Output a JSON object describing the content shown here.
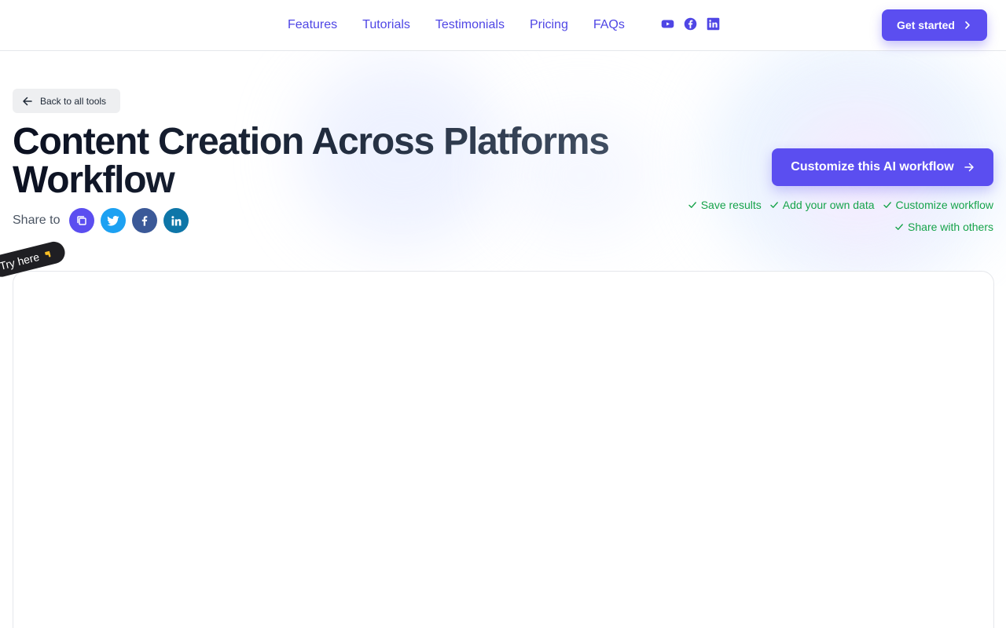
{
  "nav": {
    "items": [
      {
        "label": "Features"
      },
      {
        "label": "Tutorials"
      },
      {
        "label": "Testimonials"
      },
      {
        "label": "Pricing"
      },
      {
        "label": "FAQs"
      }
    ],
    "socials": [
      "youtube-icon",
      "facebook-icon",
      "linkedin-icon"
    ],
    "cta_label": "Get started"
  },
  "back_label": "Back to all tools",
  "title": "Content Creation Across Platforms Workflow",
  "share": {
    "label": "Share to",
    "buttons": [
      "copy-link-icon",
      "twitter-icon",
      "facebook-icon",
      "linkedin-icon"
    ]
  },
  "customize_label": "Customize this AI workflow",
  "features": [
    "Save results",
    "Add your own data",
    "Customize workflow",
    "Share with others"
  ],
  "try_here": "Try here",
  "colors": {
    "accent": "#5b4ef0",
    "nav_link": "#4f46e5",
    "feature_green": "#16a34a",
    "twitter": "#1da1f2",
    "facebook": "#3b5998",
    "linkedin": "#0e76a8"
  }
}
